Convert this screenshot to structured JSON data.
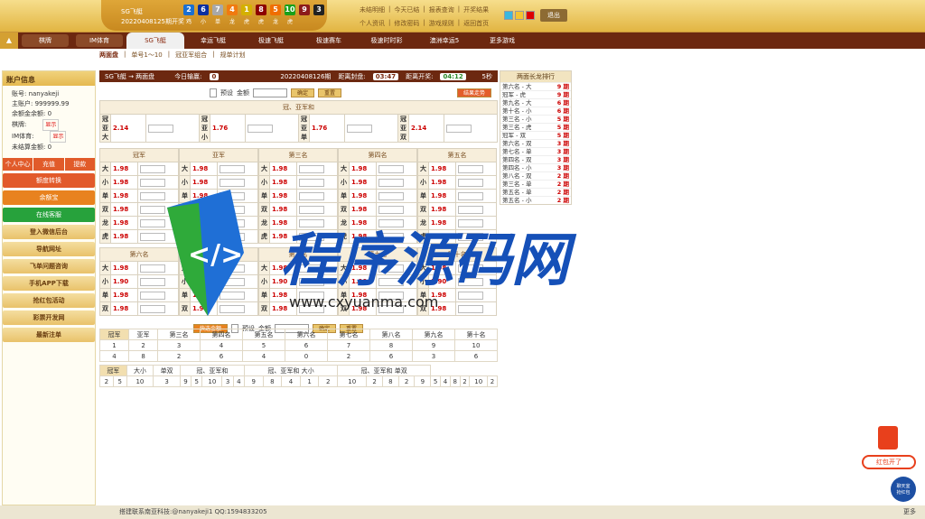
{
  "brand": {
    "title": "SG飞艇",
    "issue": "20220408125期开奖"
  },
  "balls": [
    {
      "n": "2",
      "z": "鸡",
      "c": "#1a6fd1"
    },
    {
      "n": "6",
      "z": "小",
      "c": "#0b2fa0"
    },
    {
      "n": "7",
      "z": "单",
      "c": "#a8a8a8"
    },
    {
      "n": "4",
      "z": "龙",
      "c": "#f07a10"
    },
    {
      "n": "1",
      "z": "虎",
      "c": "#d4b000"
    },
    {
      "n": "8",
      "z": "虎",
      "c": "#8c0000"
    },
    {
      "n": "5",
      "z": "龙",
      "c": "#f06e00"
    },
    {
      "n": "10",
      "z": "虎",
      "c": "#19a019"
    },
    {
      "n": "9",
      "z": "",
      "c": "#8c1a1a"
    },
    {
      "n": "3",
      "z": "",
      "c": "#222"
    }
  ],
  "toplinks": [
    [
      "未结明细",
      "今天已结",
      "报表查询",
      "开奖结果"
    ],
    [
      "个人资讯",
      "修改密码",
      "游戏规则",
      "返回首页"
    ]
  ],
  "logout": "退出",
  "nav": {
    "home": "▲",
    "tabs": [
      "棋牌",
      "IM体育",
      "SG飞艇",
      "幸运飞艇",
      "极速飞艇",
      "极速赛车",
      "极速时时彩",
      "澳洲幸运5",
      "更多游戏"
    ]
  },
  "subnav": [
    "两面盘",
    "单号1～10",
    "冠亚军组合",
    "规单计划"
  ],
  "side": {
    "title": "账户信息",
    "account": "账号: nanyakeji",
    "main": "主账户: 999999.99",
    "unsettled": "余额金余额: 0",
    "chess": "棋牌:",
    "chess_btn": "显示",
    "im": "IM体育:",
    "im_btn": "显示",
    "pending": "未结算金额: 0",
    "btns3": [
      "个人中心",
      "充值",
      "提款"
    ],
    "btn_exchange": "额度转换",
    "btn_balance": "余额宝",
    "btn_service": "在线客服",
    "links": [
      "登入微信后台",
      "导航网址",
      "飞单问题咨询",
      "手机APP下载",
      "抢红包活动",
      "彩票开发网",
      "最新注单"
    ]
  },
  "info": {
    "name": "SG飞艇 → 两面盘",
    "today_label": "今日输赢:",
    "today": "0",
    "issue": "20220408126期",
    "close_label": "距离封盘:",
    "close": "03:47",
    "open_label": "距离开奖:",
    "open": "04:12",
    "sec": "5秒"
  },
  "bet": {
    "preset": "预设",
    "amount": "金额",
    "confirm": "确定",
    "reset": "重置",
    "rule": "结果走势",
    "quick": "快选金额"
  },
  "gyh": {
    "title": "冠、亚军和",
    "items": [
      {
        "l": "冠亚大",
        "o": "2.14"
      },
      {
        "l": "冠亚小",
        "o": "1.76"
      },
      {
        "l": "冠亚单",
        "o": "1.76"
      },
      {
        "l": "冠亚双",
        "o": "2.14"
      }
    ]
  },
  "rows": [
    "大",
    "小",
    "单",
    "双",
    "龙",
    "虎"
  ],
  "rows2": [
    "大",
    "小",
    "单",
    "双"
  ],
  "pos1": [
    "冠军",
    "亚军",
    "第三名",
    "第四名",
    "第五名"
  ],
  "pos2": [
    "第六名",
    "第七名",
    "第八名",
    "第九名",
    "第十名"
  ],
  "odds": "1.98",
  "odds2": "1.90",
  "rank": {
    "title": "两面长龙排行",
    "items": [
      [
        "第六名 - 大",
        "9 期"
      ],
      [
        "冠军 - 虎",
        "9 期"
      ],
      [
        "第九名 - 大",
        "6 期"
      ],
      [
        "第十名 - 小",
        "6 期"
      ],
      [
        "第三名 - 小",
        "5 期"
      ],
      [
        "第三名 - 虎",
        "5 期"
      ],
      [
        "冠军 - 双",
        "5 期"
      ],
      [
        "第六名 - 双",
        "3 期"
      ],
      [
        "第七名 - 单",
        "3 期"
      ],
      [
        "第四名 - 双",
        "3 期"
      ],
      [
        "第四名 - 小",
        "3 期"
      ],
      [
        "第八名 - 双",
        "2 期"
      ],
      [
        "第三名 - 单",
        "2 期"
      ],
      [
        "第五名 - 单",
        "2 期"
      ],
      [
        "第五名 - 小",
        "2 期"
      ]
    ]
  },
  "hist": {
    "tabs": [
      "冠军",
      "亚军",
      "第三名",
      "第四名",
      "第五名",
      "第六名",
      "第七名",
      "第八名",
      "第九名",
      "第十名"
    ],
    "nums": [
      "1",
      "2",
      "3",
      "4",
      "5",
      "6",
      "7",
      "8",
      "9",
      "10"
    ],
    "counts": [
      "4",
      "8",
      "2",
      "6",
      "4",
      "0",
      "2",
      "6",
      "3",
      "6"
    ],
    "tabs2": [
      "冠军",
      "大小",
      "单双",
      "冠、亚军和",
      "冠、亚军和 大小",
      "冠、亚军和 单双"
    ],
    "seq": [
      "2",
      "5",
      "10",
      "3",
      "9",
      "5",
      "10",
      "3",
      "4",
      "9",
      "8",
      "4",
      "1",
      "2",
      "10",
      "2",
      "8",
      "2",
      "9",
      "5",
      "4",
      "8",
      "2",
      "10",
      "2"
    ]
  },
  "footer": "搭建联系南亚科技:@nanyakeji1 QQ:1594833205",
  "more": "更多",
  "watermark": {
    "cn": "程序源码网",
    "url": "www.cxyuanma.com"
  },
  "redpack": {
    "t1": "红包开了",
    "t2": "聊天室",
    "t3": "抢红包"
  }
}
